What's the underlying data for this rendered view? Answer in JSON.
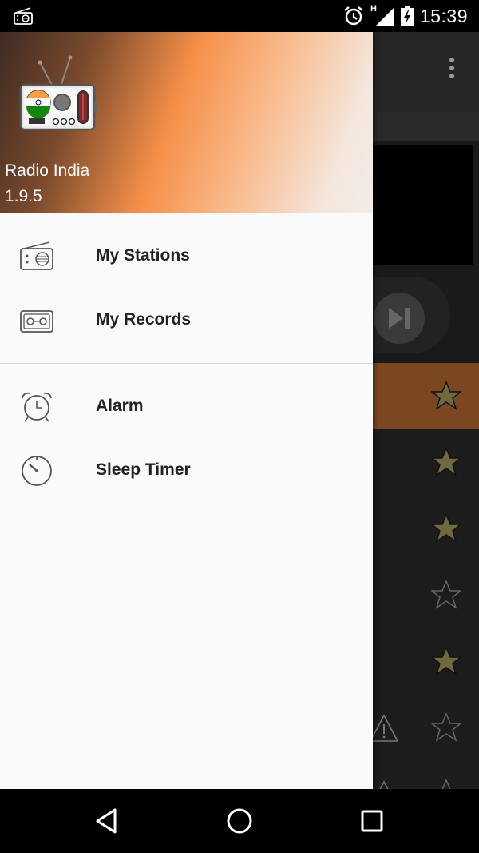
{
  "status_bar": {
    "time": "15:39",
    "network_label": "H",
    "icons": [
      "radio-notification-icon",
      "alarm-icon",
      "signal-icon",
      "battery-charging-icon"
    ]
  },
  "drawer": {
    "header": {
      "app_name": "Radio India",
      "version": "1.9.5",
      "logo": "radio-india-logo"
    },
    "primary_items": [
      {
        "label": "My Stations",
        "icon": "radio-icon"
      },
      {
        "label": "My Records",
        "icon": "cassette-icon"
      }
    ],
    "secondary_items": [
      {
        "label": "Alarm",
        "icon": "alarm-clock-icon"
      },
      {
        "label": "Sleep Timer",
        "icon": "timer-icon"
      }
    ]
  },
  "background_list": {
    "favorites": [
      true,
      true,
      true,
      false,
      true,
      false
    ],
    "active_row": 0
  },
  "nav_bar": {
    "buttons": [
      "back-icon",
      "home-icon",
      "recents-icon"
    ]
  },
  "colors": {
    "accent": "#f58f48",
    "active_row": "#7a4720",
    "drawer_bg": "#fafafa",
    "star_filled": "#6e6a3e"
  }
}
